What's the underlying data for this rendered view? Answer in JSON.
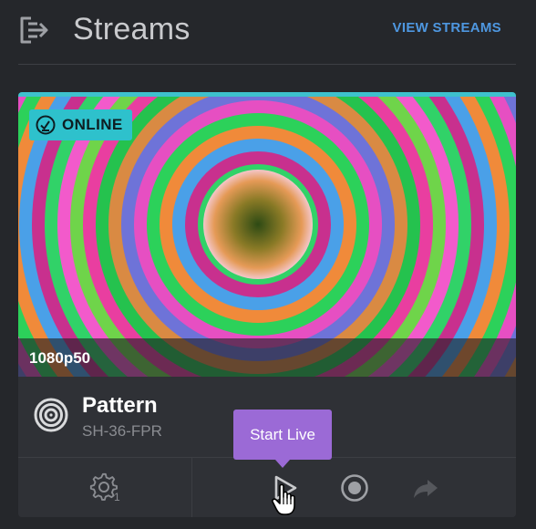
{
  "header": {
    "title": "Streams",
    "view_streams_label": "VIEW STREAMS",
    "icon": "logout-icon"
  },
  "stream_card": {
    "status_label": "ONLINE",
    "status_icon": "check-circle-icon",
    "resolution": "1080p50",
    "source_name": "Pattern",
    "source_id": "SH-36-FPR",
    "source_icon": "concentric-rings-icon",
    "settings_count": "1",
    "tooltip": "Start Live"
  },
  "colors": {
    "accent_online": "#2ec1cc",
    "link_blue": "#4e97e0",
    "tooltip_purple": "#9b6ad6",
    "background": "#25272b",
    "card": "#2f3136"
  }
}
